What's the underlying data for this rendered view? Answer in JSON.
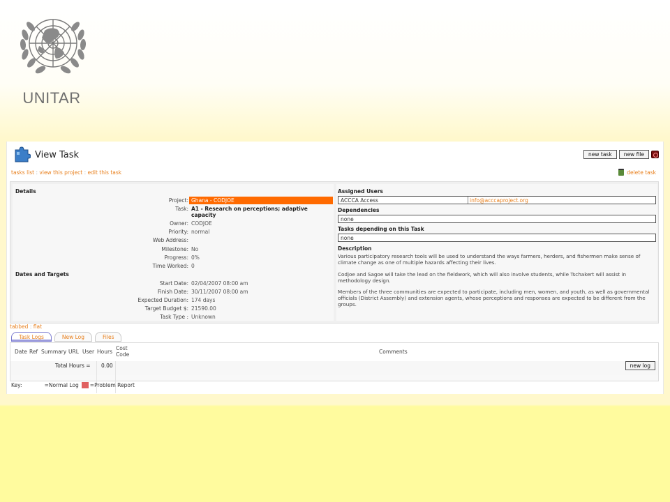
{
  "logo": {
    "text": "UNITAR"
  },
  "header": {
    "title": "View Task",
    "new_task": "new task",
    "new_file": "new file"
  },
  "breadcrumbs": {
    "tasks_list": "tasks list",
    "sep": ":",
    "view_project": "view this project",
    "edit_task": "edit this task"
  },
  "delete_task": "delete task",
  "details": {
    "heading": "Details",
    "fields": [
      {
        "label": "Project:",
        "value": "Ghana - CODJOE"
      },
      {
        "label": "Task:",
        "value": "A1 - Research on perceptions; adaptive capacity"
      },
      {
        "label": "Owner:",
        "value": "CODJOE"
      },
      {
        "label": "Priority:",
        "value": "normal"
      },
      {
        "label": "Web Address:",
        "value": ""
      },
      {
        "label": "Milestone:",
        "value": "No"
      },
      {
        "label": "Progress:",
        "value": "0%"
      },
      {
        "label": "Time Worked:",
        "value": "0"
      }
    ]
  },
  "dates": {
    "heading": "Dates and Targets",
    "fields": [
      {
        "label": "Start Date:",
        "value": "02/04/2007 08:00 am"
      },
      {
        "label": "Finish Date:",
        "value": "30/11/2007 08:00 am"
      },
      {
        "label": "Expected Duration:",
        "value": "174 days"
      },
      {
        "label": "Target Budget $:",
        "value": "21590.00"
      },
      {
        "label": "Task Type :",
        "value": "Unknown"
      }
    ]
  },
  "assigned": {
    "heading": "Assigned Users",
    "user": "ACCCA Access",
    "email": "info@acccaproject.org"
  },
  "dependencies": {
    "heading": "Dependencies",
    "value": "none"
  },
  "depending": {
    "heading": "Tasks depending on this Task",
    "value": "none"
  },
  "description": {
    "heading": "Description",
    "p1": "Various participatory research tools will be used to understand the ways farmers, herders, and fishermen make sense of climate change as one of multiple hazards affecting their lives.",
    "p2": "Codjoe and Sagoe will take the lead on the fieldwork, which will also involve students, while Tschakert will assist in methodology design.",
    "p3": "Members of the three communities are expected to participate, including men, women, and youth, as well as governmental officials (District Assembly) and extension agents, whose perceptions and responses are expected to be different from the groups."
  },
  "view_links": {
    "tabbed": "tabbed",
    "sep": ":",
    "flat": "flat"
  },
  "tabs": [
    "Task Logs",
    "New Log",
    "Files"
  ],
  "log": {
    "columns": [
      "Date",
      "Ref",
      "Summary",
      "URL",
      "User",
      "Hours"
    ],
    "cost_code": [
      "Cost",
      "Code"
    ],
    "comments": "Comments",
    "total_label": "Total Hours =",
    "total_value": "0.00",
    "new_log": "new log"
  },
  "key": {
    "label": "Key:",
    "normal": "=Normal Log",
    "problem": "=Problem Report"
  },
  "colors": {
    "accent": "#e8801e",
    "project_bg": "#ff6a00",
    "problem": "#e06060"
  }
}
